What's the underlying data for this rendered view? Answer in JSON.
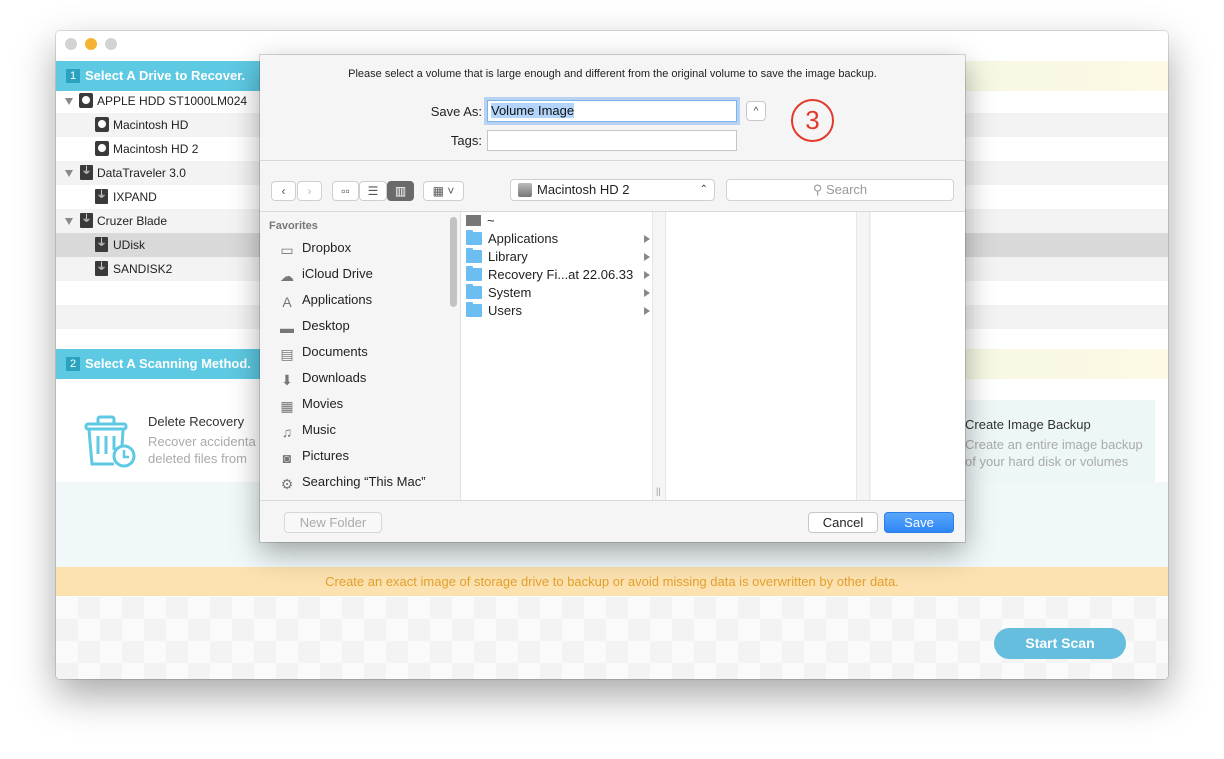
{
  "app": {
    "section1": {
      "number": "1",
      "title": "Select A Drive to Recover."
    },
    "drives": [
      {
        "name": "APPLE HDD ST1000LM024",
        "type": "hdd",
        "level": 0,
        "expanded": true
      },
      {
        "name": "Macintosh HD",
        "type": "hdd",
        "level": 1
      },
      {
        "name": "Macintosh HD 2",
        "type": "hdd",
        "level": 1
      },
      {
        "name": "DataTraveler 3.0",
        "type": "usb",
        "level": 0,
        "expanded": true
      },
      {
        "name": "IXPAND",
        "type": "usb",
        "level": 1
      },
      {
        "name": "Cruzer Blade",
        "type": "usb",
        "level": 0,
        "expanded": true
      },
      {
        "name": "UDisk",
        "type": "usb",
        "level": 1,
        "selected": true
      },
      {
        "name": "SANDISK2",
        "type": "usb",
        "level": 1
      }
    ],
    "section2": {
      "number": "2",
      "title": "Select A Scanning Method."
    },
    "methods": [
      {
        "title": "Delete Recovery",
        "desc_line1": "Recover accidenta",
        "desc_line2": "deleted files from ",
        "icon": "trash-clock-icon"
      },
      {
        "title": "Create Image Backup",
        "desc_line1": "Create an entire image backup",
        "desc_line2": "of your hard disk or volumes"
      }
    ],
    "tip": "Create an exact image of storage drive to backup or avoid missing data is overwritten by other data.",
    "start_scan": "Start Scan",
    "colors": {
      "accent": "#5ec9e3",
      "tip_bg": "#fbe2b0",
      "tip_text": "#e4a12e",
      "button": "#65bede"
    }
  },
  "dialog": {
    "message": "Please select a volume that is large enough and different from the original volume to save the image backup.",
    "save_as_label": "Save As:",
    "save_as_value": "Volume Image",
    "tags_label": "Tags:",
    "tags_value": "",
    "step_badge": "3",
    "location": "Macintosh HD 2",
    "search_placeholder": "Search",
    "favorites_header": "Favorites",
    "favorites": [
      {
        "label": "Dropbox",
        "icon": "folder-icon"
      },
      {
        "label": "iCloud Drive",
        "icon": "cloud-icon"
      },
      {
        "label": "Applications",
        "icon": "applications-icon"
      },
      {
        "label": "Desktop",
        "icon": "desktop-icon"
      },
      {
        "label": "Documents",
        "icon": "documents-icon"
      },
      {
        "label": "Downloads",
        "icon": "downloads-icon"
      },
      {
        "label": "Movies",
        "icon": "movies-icon"
      },
      {
        "label": "Music",
        "icon": "music-icon"
      },
      {
        "label": "Pictures",
        "icon": "camera-icon"
      },
      {
        "label": "Searching “This Mac”",
        "icon": "gear-icon"
      }
    ],
    "files": [
      {
        "name": "~",
        "kind": "disk"
      },
      {
        "name": "Applications",
        "kind": "folder"
      },
      {
        "name": "Library",
        "kind": "folder"
      },
      {
        "name": "Recovery Fi...at 22.06.33",
        "kind": "folder"
      },
      {
        "name": "System",
        "kind": "folder"
      },
      {
        "name": "Users",
        "kind": "folder"
      }
    ],
    "new_folder": "New Folder",
    "cancel": "Cancel",
    "save": "Save"
  }
}
